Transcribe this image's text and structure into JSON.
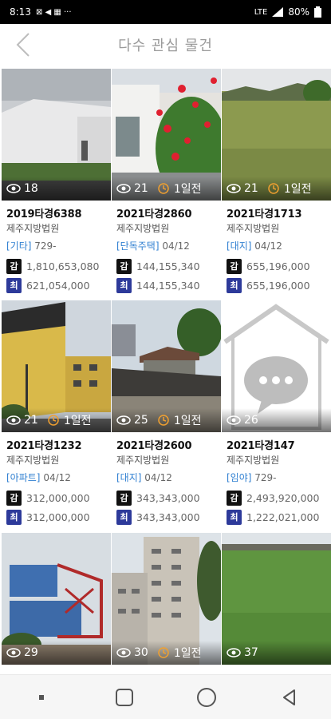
{
  "status": {
    "time": "8:13",
    "left_extra": "⊠ ◀ ▦ ···",
    "network": "LTE",
    "battery": "80%"
  },
  "header": {
    "title": "다수 관심 물건"
  },
  "cards": [
    {
      "views": "18",
      "ago": "",
      "caseno": "2019타경6388",
      "court": "제주지방법원",
      "type": "[기타]",
      "date": "729-",
      "appraisal": "1,810,653,080",
      "minimum": "621,054,000"
    },
    {
      "views": "21",
      "ago": "1일전",
      "caseno": "2021타경2860",
      "court": "제주지방법원",
      "type": "[단독주택]",
      "date": "04/12",
      "appraisal": "144,155,340",
      "minimum": "144,155,340"
    },
    {
      "views": "21",
      "ago": "1일전",
      "caseno": "2021타경1713",
      "court": "제주지방법원",
      "type": "[대지]",
      "date": "04/12",
      "appraisal": "655,196,000",
      "minimum": "655,196,000"
    },
    {
      "views": "21",
      "ago": "1일전",
      "caseno": "2021타경1232",
      "court": "제주지방법원",
      "type": "[아파트]",
      "date": "04/12",
      "appraisal": "312,000,000",
      "minimum": "312,000,000"
    },
    {
      "views": "25",
      "ago": "1일전",
      "caseno": "2021타경2600",
      "court": "제주지방법원",
      "type": "[대지]",
      "date": "04/12",
      "appraisal": "343,343,000",
      "minimum": "343,343,000"
    },
    {
      "views": "26",
      "ago": "",
      "caseno": "2021타경147",
      "court": "제주지방법원",
      "type": "[임야]",
      "date": "729-",
      "appraisal": "2,493,920,000",
      "minimum": "1,222,021,000"
    },
    {
      "views": "29",
      "ago": ""
    },
    {
      "views": "30",
      "ago": "1일전"
    },
    {
      "views": "37",
      "ago": ""
    }
  ],
  "labels": {
    "appraisal_badge": "감",
    "minimum_badge": "최"
  },
  "colors": {
    "type_blue": "#2f7fd1",
    "badge_black": "#111111",
    "badge_navy": "#2d3a9a",
    "clock_orange": "#f0a030"
  }
}
